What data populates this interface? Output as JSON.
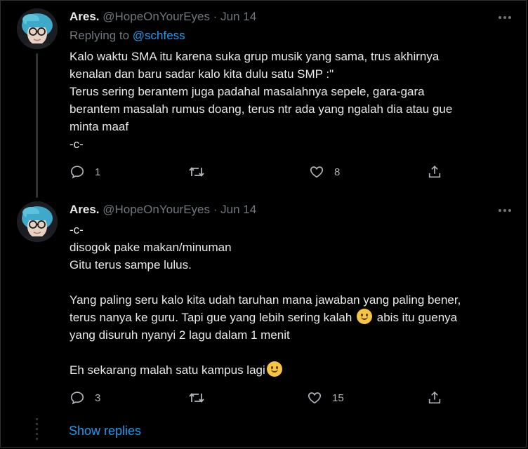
{
  "tweets": [
    {
      "name": "Ares.",
      "handle": "@HopeOnYourEyes",
      "separator": "·",
      "date": "Jun 14",
      "replying_prefix": "Replying to ",
      "replying_to": "@schfess",
      "lines": [
        "Kalo waktu SMA itu karena suka grup musik yang sama, trus akhirnya",
        "kenalan dan baru sadar kalo kita dulu satu SMP :\"",
        "Terus sering berantem juga padahal masalahnya sepele, gara-gara",
        "berantem masalah rumus doang, terus ntr ada yang ngalah dia atau gue",
        "minta maaf",
        "-c-"
      ],
      "replies": "1",
      "retweets": "",
      "likes": "8"
    },
    {
      "name": "Ares.",
      "handle": "@HopeOnYourEyes",
      "separator": "·",
      "date": "Jun 14",
      "lines": [
        "-c-",
        "disogok pake makan/minuman",
        "Gitu terus sampe lulus.",
        "Yang paling seru kalo kita udah taruhan mana jawaban yang paling bener,",
        "terus nanya ke guru. Tapi gue yang lebih sering kalah",
        "abis itu guenya",
        "yang disuruh nyanyi 2 lagu dalam 1 menit",
        "Eh sekarang malah satu kampus lagi"
      ],
      "emoji": "slightly-smiling-face",
      "replies": "3",
      "retweets": "",
      "likes": "15"
    }
  ],
  "show_replies": "Show replies",
  "icons": {
    "reply": "reply-icon",
    "retweet": "retweet-icon",
    "like": "heart-icon",
    "share": "share-icon",
    "more": "more-icon"
  },
  "colors": {
    "background": "#000000",
    "text": "#e7e9ea",
    "secondary": "#71767b",
    "accent": "#1d9bf0",
    "thread_line": "#2f3336"
  }
}
